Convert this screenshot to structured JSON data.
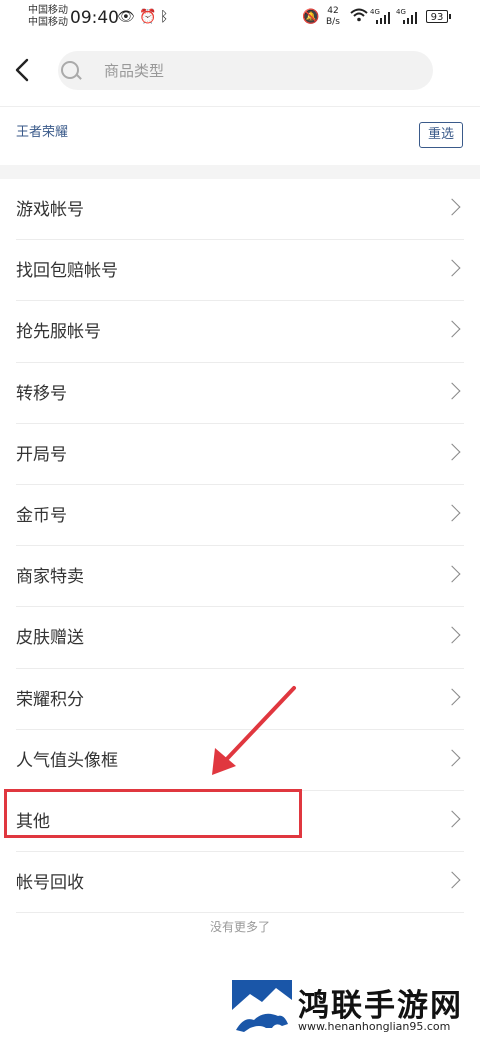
{
  "status_bar": {
    "carrier_1": "中国移动",
    "carrier_2": "中国移动",
    "time": "09:40",
    "net_speed_value": "42",
    "net_speed_unit": "B/s",
    "network_1": "4G",
    "network_2": "4G",
    "battery": "93"
  },
  "search": {
    "placeholder": "商品类型"
  },
  "filter": {
    "selected_game": "王者荣耀",
    "reset_label": "重选"
  },
  "categories": [
    "游戏帐号",
    "找回包赔帐号",
    "抢先服帐号",
    "转移号",
    "开局号",
    "金币号",
    "商家特卖",
    "皮肤赠送",
    "荣耀积分",
    "人气值头像框",
    "其他",
    "帐号回收"
  ],
  "highlighted_category": "其他",
  "footer": {
    "no_more": "没有更多了"
  },
  "watermark": {
    "title": "鸿联手游网",
    "url": "www.henanhonglian95.com"
  },
  "colors": {
    "accent": "#3a5a8a",
    "annotation": "#e0373f"
  }
}
